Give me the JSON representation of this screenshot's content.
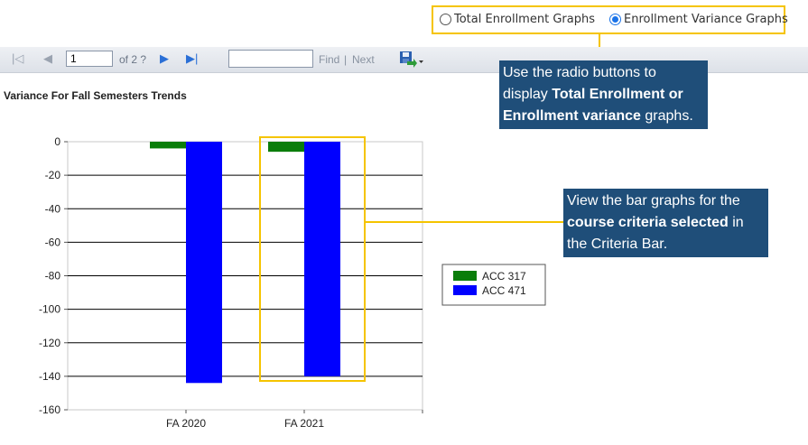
{
  "radio": {
    "options": [
      {
        "label": "Total Enrollment Graphs",
        "checked": false
      },
      {
        "label": "Enrollment Variance Graphs",
        "checked": true
      }
    ]
  },
  "toolbar": {
    "first_icon": "first-page-icon",
    "prev_icon": "previous-page-icon",
    "page_value": "1",
    "of_text": "of 2 ?",
    "next_icon": "next-page-icon",
    "last_icon": "last-page-icon",
    "find_value": "",
    "find_label": "Find",
    "separator": "|",
    "next_label": "Next",
    "export_icon": "save-export-icon"
  },
  "callouts": {
    "radio_help": {
      "line1": "Use the radio buttons to",
      "line2_pre": "display ",
      "line2_bold": "Total Enrollment or",
      "line3_bold": "Enrollment variance",
      "line3_post": " graphs."
    },
    "bar_help": {
      "line1": "View the bar graphs for the",
      "line2_bold": "course criteria selected",
      "line2_post": " in",
      "line3": "the Criteria Bar."
    }
  },
  "chart_title": "Variance For Fall Semesters Trends",
  "chart_data": {
    "type": "bar",
    "title": "Variance For Fall Semesters Trends",
    "categories": [
      "FA 2020",
      "FA 2021"
    ],
    "series": [
      {
        "name": "ACC 317",
        "values": [
          -4,
          -6
        ],
        "color": "#0a7d0a"
      },
      {
        "name": "ACC 471",
        "values": [
          -144,
          -140
        ],
        "color": "#0000ff"
      }
    ],
    "ylim": [
      -160,
      0
    ],
    "yticks": [
      0,
      -20,
      -40,
      -60,
      -80,
      -100,
      -120,
      -140,
      -160
    ],
    "ytick_labels": [
      "0",
      "-20",
      "-40",
      "-60",
      "-80",
      "-100",
      "-120",
      "-140",
      "-160"
    ],
    "grid": true,
    "legend_position": "right"
  },
  "colors": {
    "highlight": "#f5c400",
    "callout_bg": "#1f4e79",
    "radio_accent": "#1a73e8"
  }
}
